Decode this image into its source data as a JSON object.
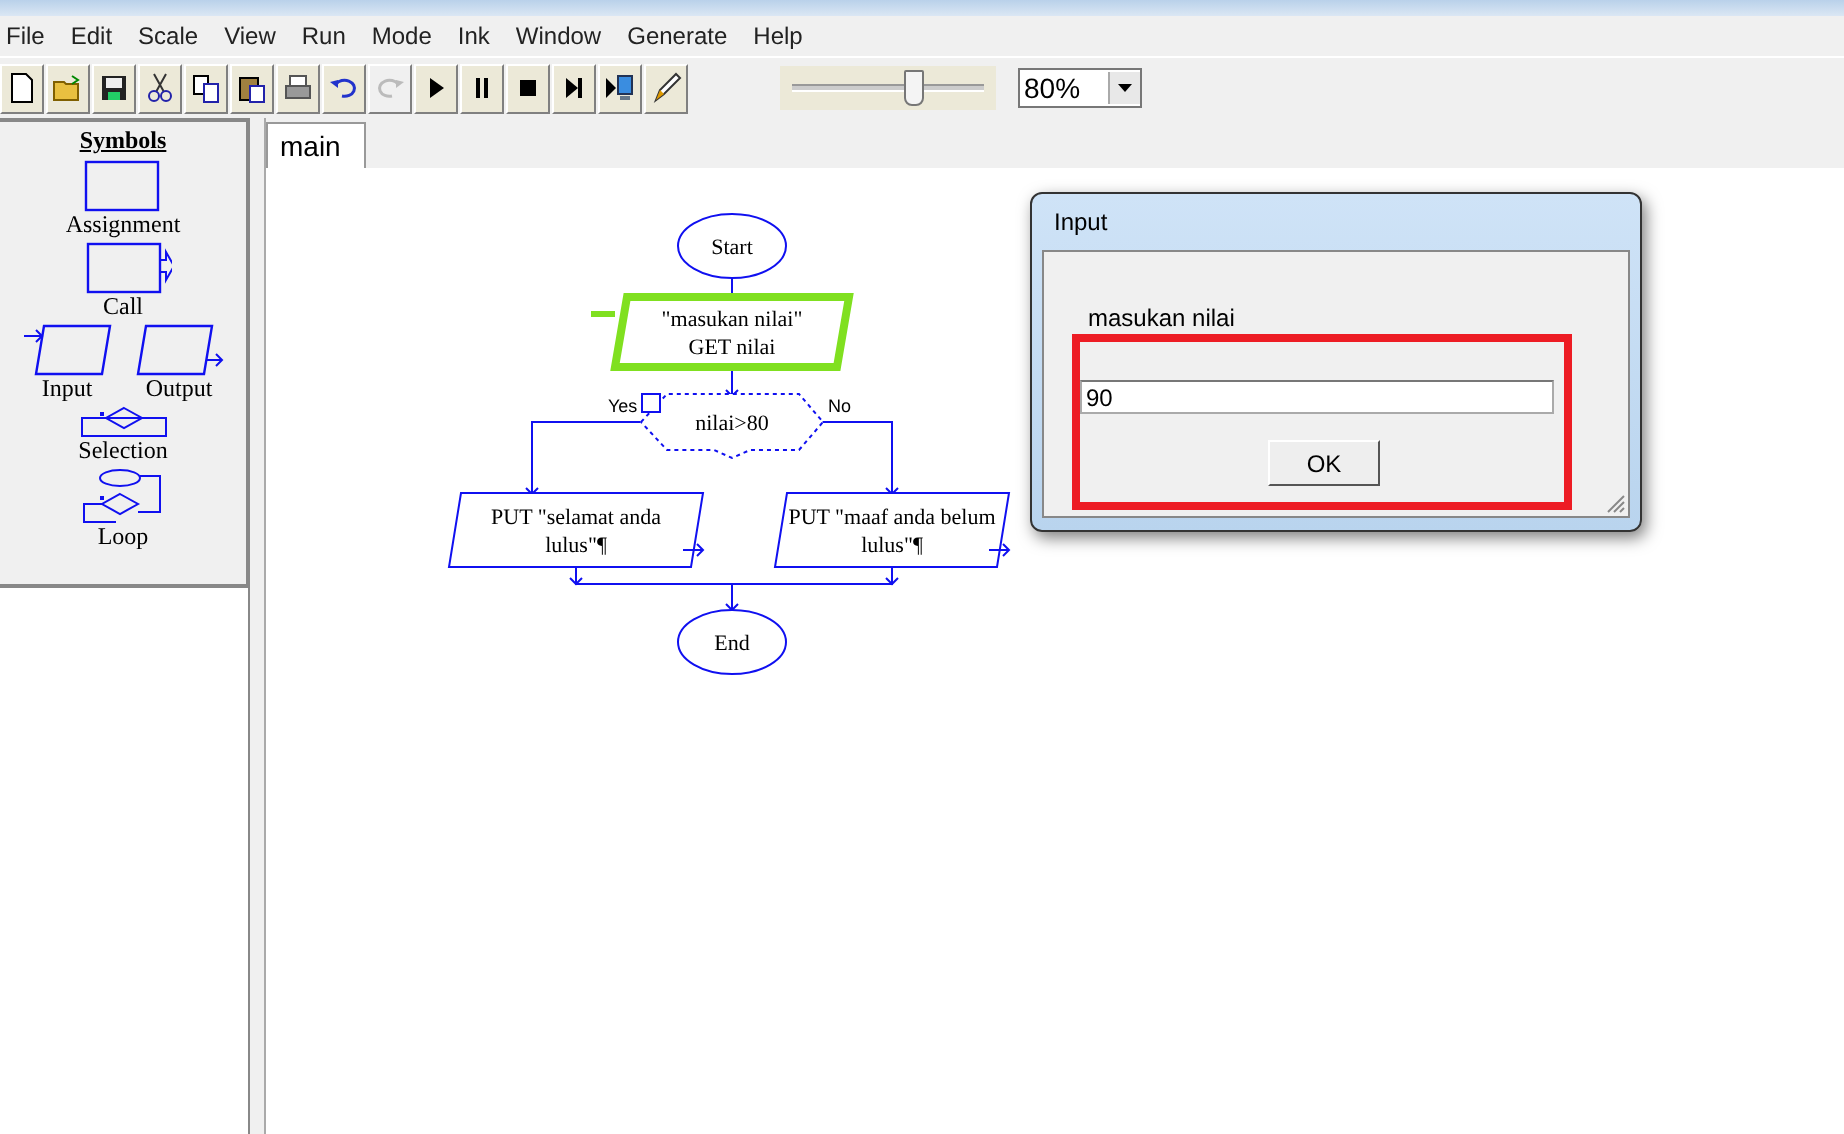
{
  "menu": [
    "File",
    "Edit",
    "Scale",
    "View",
    "Run",
    "Mode",
    "Ink",
    "Window",
    "Generate",
    "Help"
  ],
  "toolbar": [
    {
      "kind": "new",
      "disabled": false
    },
    {
      "kind": "open",
      "disabled": false
    },
    {
      "kind": "save",
      "disabled": false
    },
    {
      "kind": "cut",
      "disabled": false
    },
    {
      "kind": "copy",
      "disabled": false
    },
    {
      "kind": "paste",
      "disabled": false
    },
    {
      "kind": "print",
      "disabled": false
    },
    {
      "kind": "undo",
      "disabled": false
    },
    {
      "kind": "redo",
      "disabled": true
    },
    {
      "kind": "run",
      "disabled": false
    },
    {
      "kind": "pause",
      "disabled": false
    },
    {
      "kind": "stop",
      "disabled": false
    },
    {
      "kind": "step",
      "disabled": false
    },
    {
      "kind": "test",
      "disabled": false
    },
    {
      "kind": "pen",
      "disabled": false
    }
  ],
  "speed_slider": {
    "level": 0.63
  },
  "zoom": {
    "value": "80%"
  },
  "symbols": {
    "title": "Symbols",
    "items": [
      {
        "kind": "assignment",
        "label": "Assignment"
      },
      {
        "kind": "call",
        "label": "Call"
      },
      {
        "kind": "input",
        "label": "Input"
      },
      {
        "kind": "output",
        "label": "Output"
      },
      {
        "kind": "selection",
        "label": "Selection"
      },
      {
        "kind": "loop",
        "label": "Loop"
      }
    ]
  },
  "tabs": [
    {
      "label": "main",
      "selected": true
    }
  ],
  "flowchart": {
    "nodes": [
      {
        "kind": "terminal",
        "lines": [
          "Start"
        ],
        "active": false
      },
      {
        "kind": "input",
        "lines": [
          "\"masukan nilai\"",
          "GET nilai"
        ],
        "active": true
      },
      {
        "kind": "decision",
        "lines": [
          "nilai>80"
        ],
        "yes_label": "Yes",
        "no_label": "No",
        "active": false
      },
      {
        "kind": "output",
        "lines": [
          "PUT \"selamat anda",
          "lulus\"¶"
        ],
        "active": false
      },
      {
        "kind": "output",
        "lines": [
          "PUT \"maaf anda belum",
          "lulus\"¶"
        ],
        "active": false
      },
      {
        "kind": "terminal",
        "lines": [
          "End"
        ],
        "active": false
      }
    ]
  },
  "dialog": {
    "title": "Input",
    "prompt": "masukan nilai",
    "value": "90",
    "button": "OK"
  }
}
